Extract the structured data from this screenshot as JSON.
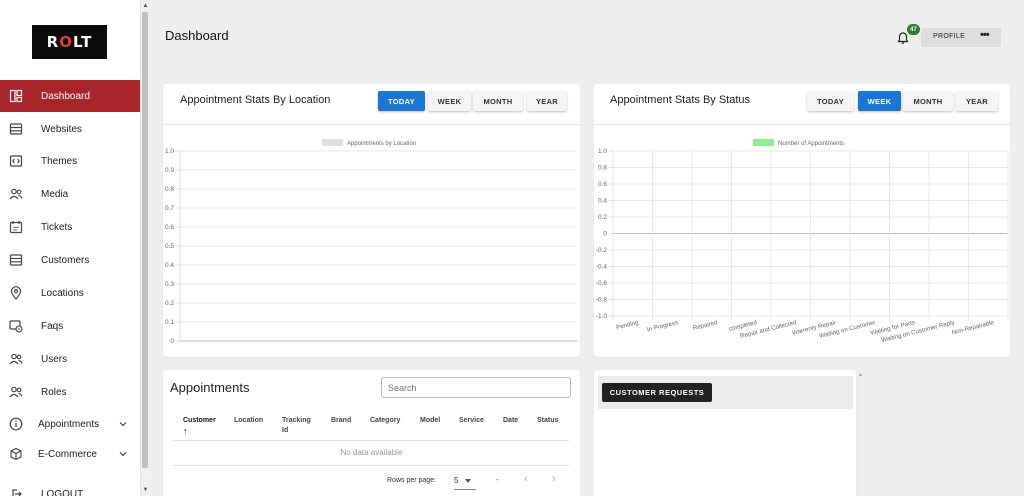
{
  "brand": {
    "logo_text_pre": "R",
    "logo_text_accent": "O",
    "logo_text_post": "LT",
    "accent_color": "#e53935"
  },
  "sidebar": {
    "active_color": "#a8262a",
    "items": [
      {
        "label": "Dashboard",
        "icon": "dashboard-icon",
        "active": true
      },
      {
        "label": "Websites",
        "icon": "website-icon"
      },
      {
        "label": "Themes",
        "icon": "code-icon"
      },
      {
        "label": "Media",
        "icon": "people-icon"
      },
      {
        "label": "Tickets",
        "icon": "calendar-icon"
      },
      {
        "label": "Customers",
        "icon": "website-icon"
      },
      {
        "label": "Locations",
        "icon": "location-pin-icon"
      },
      {
        "label": "Faqs",
        "icon": "faq-icon"
      },
      {
        "label": "Users",
        "icon": "people-icon"
      },
      {
        "label": "Roles",
        "icon": "people-icon"
      },
      {
        "label": "Appointments",
        "icon": "info-icon",
        "expandable": true
      },
      {
        "label": "E-Commerce",
        "icon": "box-icon",
        "expandable": true
      },
      {
        "label": "LOGOUT",
        "icon": "logout-icon"
      }
    ]
  },
  "header": {
    "title": "Dashboard",
    "notification_count": "47",
    "profile_label": "PROFILE",
    "profile_menu_icon": "more-horizontal-icon"
  },
  "location_card": {
    "title": "Appointment Stats By Location",
    "ranges": [
      "TODAY",
      "WEEK",
      "MONTH",
      "YEAR"
    ],
    "selected_range": "TODAY"
  },
  "status_card": {
    "title": "Appointment Stats By Status",
    "ranges": [
      "TODAY",
      "WEEK",
      "MONTH",
      "YEAR"
    ],
    "selected_range": "WEEK"
  },
  "chart_data": [
    {
      "type": "bar",
      "legend": "Appointments by Location",
      "legend_color": "#e0e0e0",
      "categories": [],
      "values": [],
      "y_ticks": [
        "1.0",
        "0.9",
        "0.8",
        "0.7",
        "0.6",
        "0.5",
        "0.4",
        "0.3",
        "0.2",
        "0.1",
        "0"
      ],
      "ylim": [
        0,
        1.0
      ],
      "grid": true
    },
    {
      "type": "bar",
      "legend": "Number of Appointments",
      "legend_color": "#90ee90",
      "categories": [
        "Pending",
        "In Progress",
        "Repaired",
        "completed",
        "Repair and Collected",
        "Warrenty Repair",
        "Waiting on Customer",
        "Waiting for Parts",
        "Waiting on Customer Reply",
        "Non-Repairable"
      ],
      "values": [
        0,
        0,
        0,
        0,
        0,
        0,
        0,
        0,
        0,
        0
      ],
      "y_ticks": [
        "1.0",
        "0.8",
        "0.6",
        "0.4",
        "0.2",
        "0",
        "-0.2",
        "-0.4",
        "-0.6",
        "-0.8",
        "-1.0"
      ],
      "ylim": [
        -1.0,
        1.0
      ],
      "grid": true
    }
  ],
  "appointments": {
    "title": "Appointments",
    "search_placeholder": "Search",
    "columns": [
      "Customer",
      "Location",
      "Tracking Id",
      "Brand",
      "Category",
      "Model",
      "Service",
      "Date",
      "Status"
    ],
    "sorted_column": "Customer",
    "empty_text": "No data available",
    "rows_per_page_label": "Rows per page:",
    "rows_per_page": "5",
    "range_text": "-"
  },
  "customer_requests": {
    "button_label": "CUSTOMER REQUESTS"
  }
}
